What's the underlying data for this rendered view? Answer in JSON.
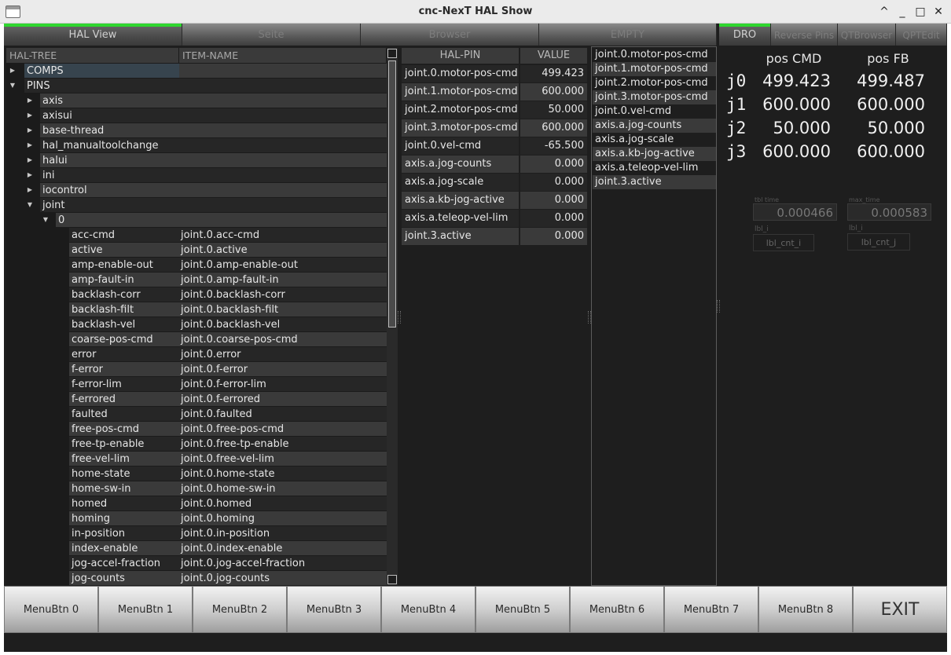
{
  "window": {
    "title": "cnc-NexT HAL Show",
    "controls": [
      "^",
      "_",
      "□",
      "✕"
    ]
  },
  "tabs_left": [
    "HAL View",
    "Seite",
    "Browser",
    "EMPTY"
  ],
  "tabs_right": [
    "DRO",
    "Reverse Pins",
    "QTBrowser",
    "QPTEdit"
  ],
  "tree": {
    "headers": [
      "HAL-TREE",
      "ITEM-NAME"
    ],
    "rows": [
      {
        "label": "COMPS",
        "item": "",
        "level": 0,
        "arrow": "right",
        "selected": true
      },
      {
        "label": "PINS",
        "item": "",
        "level": 0,
        "arrow": "down"
      },
      {
        "label": "axis",
        "item": "",
        "level": 1,
        "arrow": "right"
      },
      {
        "label": "axisui",
        "item": "",
        "level": 1,
        "arrow": "right"
      },
      {
        "label": "base-thread",
        "item": "",
        "level": 1,
        "arrow": "right"
      },
      {
        "label": "hal_manualtoolchange",
        "item": "",
        "level": 1,
        "arrow": "right"
      },
      {
        "label": "halui",
        "item": "",
        "level": 1,
        "arrow": "right"
      },
      {
        "label": "ini",
        "item": "",
        "level": 1,
        "arrow": "right"
      },
      {
        "label": "iocontrol",
        "item": "",
        "level": 1,
        "arrow": "right"
      },
      {
        "label": "joint",
        "item": "",
        "level": 1,
        "arrow": "down"
      },
      {
        "label": "0",
        "item": "",
        "level": 2,
        "arrow": "down"
      },
      {
        "label": "acc-cmd",
        "item": "joint.0.acc-cmd",
        "level": 3
      },
      {
        "label": "active",
        "item": "joint.0.active",
        "level": 3
      },
      {
        "label": "amp-enable-out",
        "item": "joint.0.amp-enable-out",
        "level": 3
      },
      {
        "label": "amp-fault-in",
        "item": "joint.0.amp-fault-in",
        "level": 3
      },
      {
        "label": "backlash-corr",
        "item": "joint.0.backlash-corr",
        "level": 3
      },
      {
        "label": "backlash-filt",
        "item": "joint.0.backlash-filt",
        "level": 3
      },
      {
        "label": "backlash-vel",
        "item": "joint.0.backlash-vel",
        "level": 3
      },
      {
        "label": "coarse-pos-cmd",
        "item": "joint.0.coarse-pos-cmd",
        "level": 3
      },
      {
        "label": "error",
        "item": "joint.0.error",
        "level": 3
      },
      {
        "label": "f-error",
        "item": "joint.0.f-error",
        "level": 3
      },
      {
        "label": "f-error-lim",
        "item": "joint.0.f-error-lim",
        "level": 3
      },
      {
        "label": "f-errored",
        "item": "joint.0.f-errored",
        "level": 3
      },
      {
        "label": "faulted",
        "item": "joint.0.faulted",
        "level": 3
      },
      {
        "label": "free-pos-cmd",
        "item": "joint.0.free-pos-cmd",
        "level": 3
      },
      {
        "label": "free-tp-enable",
        "item": "joint.0.free-tp-enable",
        "level": 3
      },
      {
        "label": "free-vel-lim",
        "item": "joint.0.free-vel-lim",
        "level": 3
      },
      {
        "label": "home-state",
        "item": "joint.0.home-state",
        "level": 3
      },
      {
        "label": "home-sw-in",
        "item": "joint.0.home-sw-in",
        "level": 3
      },
      {
        "label": "homed",
        "item": "joint.0.homed",
        "level": 3
      },
      {
        "label": "homing",
        "item": "joint.0.homing",
        "level": 3
      },
      {
        "label": "in-position",
        "item": "joint.0.in-position",
        "level": 3
      },
      {
        "label": "index-enable",
        "item": "joint.0.index-enable",
        "level": 3
      },
      {
        "label": "jog-accel-fraction",
        "item": "joint.0.jog-accel-fraction",
        "level": 3
      },
      {
        "label": "jog-counts",
        "item": "joint.0.jog-counts",
        "level": 3
      }
    ]
  },
  "pin_table": {
    "headers": [
      "HAL-PIN",
      "VALUE"
    ],
    "rows": [
      {
        "pin": "joint.0.motor-pos-cmd",
        "value": "499.423"
      },
      {
        "pin": "joint.1.motor-pos-cmd",
        "value": "600.000"
      },
      {
        "pin": "joint.2.motor-pos-cmd",
        "value": "50.000"
      },
      {
        "pin": "joint.3.motor-pos-cmd",
        "value": "600.000"
      },
      {
        "pin": "joint.0.vel-cmd",
        "value": "-65.500"
      },
      {
        "pin": "axis.a.jog-counts",
        "value": "0.000"
      },
      {
        "pin": "axis.a.jog-scale",
        "value": "0.000"
      },
      {
        "pin": "axis.a.kb-jog-active",
        "value": "0.000"
      },
      {
        "pin": "axis.a.teleop-vel-lim",
        "value": "0.000"
      },
      {
        "pin": "joint.3.active",
        "value": "0.000"
      }
    ]
  },
  "pin_list": [
    "joint.0.motor-pos-cmd",
    "joint.1.motor-pos-cmd",
    "joint.2.motor-pos-cmd",
    "joint.3.motor-pos-cmd",
    "joint.0.vel-cmd",
    "axis.a.jog-counts",
    "axis.a.jog-scale",
    "axis.a.kb-jog-active",
    "axis.a.teleop-vel-lim",
    "joint.3.active"
  ],
  "dro": {
    "header_cmd": "pos CMD",
    "header_fb": "pos FB",
    "rows": [
      {
        "joint": "j0",
        "cmd": "499.423",
        "fb": "499.487"
      },
      {
        "joint": "j1",
        "cmd": "600.000",
        "fb": "600.000"
      },
      {
        "joint": "j2",
        "cmd": "50.000",
        "fb": "50.000"
      },
      {
        "joint": "j3",
        "cmd": "600.000",
        "fb": "600.000"
      }
    ],
    "tbl_time_label": "tbl time",
    "tbl_time_value": "0.000466",
    "max_time_label": "max_time",
    "max_time_value": "0.000583",
    "lbl_i_1": "lbl_i",
    "lbl_i_2": "lbl_i",
    "lbl_cnt_i": "lbl_cnt_i",
    "lbl_cnt_j": "lbl_cnt_j"
  },
  "menu_buttons": [
    "MenuBtn 0",
    "MenuBtn 1",
    "MenuBtn 2",
    "MenuBtn 3",
    "MenuBtn 4",
    "MenuBtn 5",
    "MenuBtn 6",
    "MenuBtn 7",
    "MenuBtn 8"
  ],
  "exit_label": "EXIT",
  "colors": {
    "background": "#1e1e1e",
    "active_tab_indicator": "#2fd62f",
    "row_alt": "#3a3a3a",
    "row_dark": "#262626",
    "selection": "#37444e"
  }
}
